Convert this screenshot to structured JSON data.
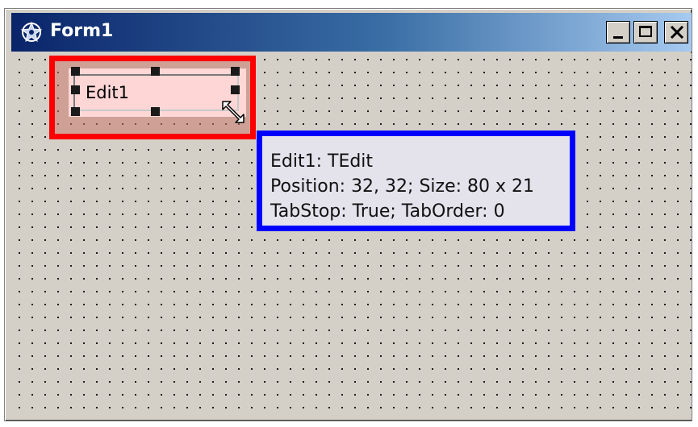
{
  "window": {
    "title": "Form1",
    "icon": "delphi-form-icon",
    "controls": {
      "minimize": "minimize-icon",
      "maximize": "maximize-icon",
      "close": "close-icon"
    }
  },
  "form": {
    "edit": {
      "text": "Edit1"
    },
    "hint": {
      "line1": "Edit1: TEdit",
      "line2": "Position: 32, 32; Size: 80 x 21",
      "line3": "TabStop: True; TabOrder: 0"
    }
  },
  "colors": {
    "titlebar_start": "#0a246a",
    "titlebar_end": "#a6caf0",
    "form_bg": "#d4d0c8",
    "highlight_red": "#ff0000",
    "highlight_blue": "#0000ff"
  }
}
